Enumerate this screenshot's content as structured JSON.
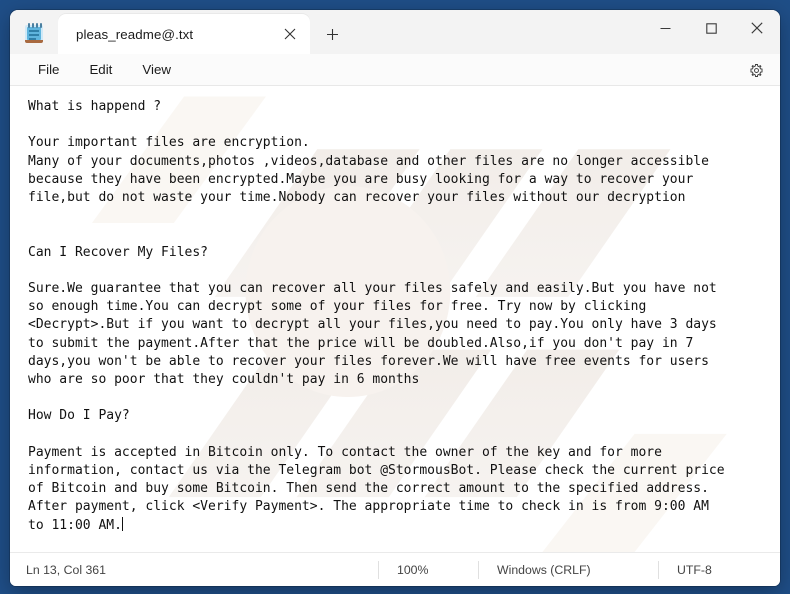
{
  "window": {
    "app_icon": "notepad-icon",
    "controls": {
      "minimize": "minimize-icon",
      "maximize": "maximize-icon",
      "close": "close-icon"
    }
  },
  "tabs": [
    {
      "label": "pleas_readme@.txt",
      "close_icon": "close-icon",
      "active": true
    }
  ],
  "newtab": {
    "icon": "plus-icon",
    "label": "+"
  },
  "menubar": {
    "items": [
      {
        "label": "File"
      },
      {
        "label": "Edit"
      },
      {
        "label": "View"
      }
    ],
    "settings_icon": "gear-icon"
  },
  "editor": {
    "content": "What is happend ?\n\nYour important files are encryption.\nMany of your documents,photos ,videos,database and other files are no longer accessible\nbecause they have been encrypted.Maybe you are busy looking for a way to recover your\nfile,but do not waste your time.Nobody can recover your files without our decryption\n\n\nCan I Recover My Files?\n\nSure.We guarantee that you can recover all your files safely and easily.But you have not\nso enough time.You can decrypt some of your files for free. Try now by clicking\n<Decrypt>.But if you want to decrypt all your files,you need to pay.You only have 3 days\nto submit the payment.After that the price will be doubled.Also,if you don't pay in 7\ndays,you won't be able to recover your files forever.We will have free events for users\nwho are so poor that they couldn't pay in 6 months\n\nHow Do I Pay?\n\nPayment is accepted in Bitcoin only. To contact the owner of the key and for more\ninformation, contact us via the Telegram bot @StormousBot. Please check the current price\nof Bitcoin and buy some Bitcoin. Then send the correct amount to the specified address.\nAfter payment, click <Verify Payment>. The appropriate time to check in is from 9:00 AM\nto 11:00 AM."
  },
  "statusbar": {
    "position": "Ln 13, Col 361",
    "zoom": "100%",
    "line_ending": "Windows (CRLF)",
    "encoding": "UTF-8"
  },
  "colors": {
    "desktop": "#1f4e87",
    "window_chrome": "#f3f3f3",
    "editor_bg": "#ffffff",
    "text": "#111111",
    "accent_close_hover": "#c42b1c"
  }
}
